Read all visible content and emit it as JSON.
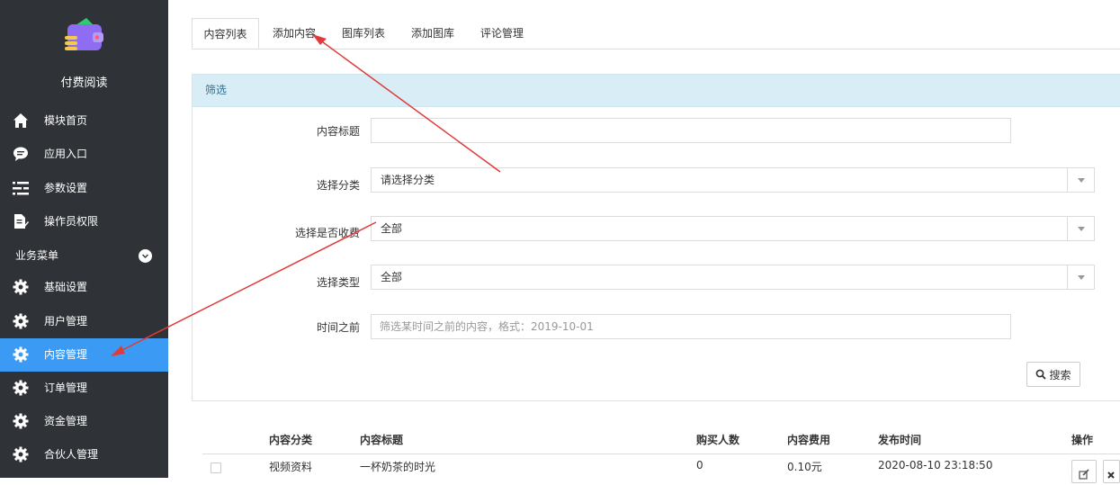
{
  "sidebar": {
    "app_name": "付费阅读",
    "items": [
      {
        "label": "模块首页",
        "icon": "home-icon"
      },
      {
        "label": "应用入口",
        "icon": "chat-bubble-icon"
      },
      {
        "label": "参数设置",
        "icon": "sliders-icon"
      },
      {
        "label": "操作员权限",
        "icon": "document-edit-icon"
      }
    ],
    "section_title": "业务菜单",
    "business_items": [
      {
        "label": "基础设置",
        "icon": "gear-icon"
      },
      {
        "label": "用户管理",
        "icon": "gear-icon"
      },
      {
        "label": "内容管理",
        "icon": "gear-icon",
        "active": true
      },
      {
        "label": "订单管理",
        "icon": "gear-icon"
      },
      {
        "label": "资金管理",
        "icon": "gear-icon"
      },
      {
        "label": "合伙人管理",
        "icon": "gear-icon"
      }
    ],
    "active_color": "#3b9bf4"
  },
  "tabs": [
    {
      "label": "内容列表",
      "active": true
    },
    {
      "label": "添加内容"
    },
    {
      "label": "图库列表"
    },
    {
      "label": "添加图库"
    },
    {
      "label": "评论管理"
    }
  ],
  "filter": {
    "title": "筛选",
    "title_label": "内容标题",
    "title_value": "",
    "category_label": "选择分类",
    "category_value": "请选择分类",
    "fee_label": "选择是否收费",
    "fee_value": "全部",
    "type_label": "选择类型",
    "type_value": "全部",
    "before_label": "时间之前",
    "before_placeholder": "筛选某时间之前的内容，格式：2019-10-01",
    "search_button": "搜索"
  },
  "table": {
    "headers": [
      "内容分类",
      "内容标题",
      "购买人数",
      "内容费用",
      "发布时间",
      "操作"
    ],
    "rows": [
      {
        "category": "视频资料",
        "title": "一杯奶茶的时光",
        "buyers": "0",
        "fee": "0.10元",
        "published": "2020-08-10 23:18:50"
      }
    ]
  },
  "colors": {
    "sidebar_bg": "#2f3237",
    "panel_head_bg": "#d9edf7",
    "annotation_arrow": "#e03a3a"
  }
}
